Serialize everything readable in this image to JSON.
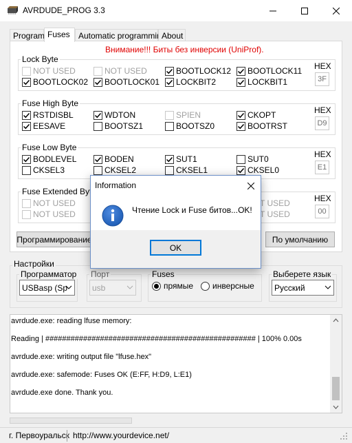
{
  "window": {
    "title": "AVRDUDE_PROG 3.3"
  },
  "tabs": [
    "Program",
    "Fuses",
    "Automatic programming",
    "About"
  ],
  "warning": "Внимание!!! Биты без инверсии (UniProf).",
  "lock_byte": {
    "title": "Lock Byte",
    "hex_label": "HEX",
    "hex_value": "3F",
    "bits": [
      {
        "label": "NOT USED",
        "checked": false,
        "disabled": true
      },
      {
        "label": "NOT USED",
        "checked": false,
        "disabled": true
      },
      {
        "label": "BOOTLOCK12",
        "checked": true,
        "disabled": false
      },
      {
        "label": "BOOTLOCK11",
        "checked": true,
        "disabled": false
      },
      {
        "label": "BOOTLOCK02",
        "checked": true,
        "disabled": false
      },
      {
        "label": "BOOTLOCK01",
        "checked": true,
        "disabled": false
      },
      {
        "label": "LOCKBIT2",
        "checked": true,
        "disabled": false
      },
      {
        "label": "LOCKBIT1",
        "checked": true,
        "disabled": false
      }
    ]
  },
  "fuse_high": {
    "title": "Fuse High Byte",
    "hex_label": "HEX",
    "hex_value": "D9",
    "bits": [
      {
        "label": "RSTDISBL",
        "checked": true,
        "disabled": false
      },
      {
        "label": "WDTON",
        "checked": true,
        "disabled": false
      },
      {
        "label": "SPIEN",
        "checked": false,
        "disabled": true
      },
      {
        "label": "CKOPT",
        "checked": true,
        "disabled": false
      },
      {
        "label": "EESAVE",
        "checked": true,
        "disabled": false
      },
      {
        "label": "BOOTSZ1",
        "checked": false,
        "disabled": false
      },
      {
        "label": "BOOTSZ0",
        "checked": false,
        "disabled": false
      },
      {
        "label": "BOOTRST",
        "checked": true,
        "disabled": false
      }
    ]
  },
  "fuse_low": {
    "title": "Fuse Low Byte",
    "hex_label": "HEX",
    "hex_value": "E1",
    "bits": [
      {
        "label": "BODLEVEL",
        "checked": true,
        "disabled": false
      },
      {
        "label": "BODEN",
        "checked": true,
        "disabled": false
      },
      {
        "label": "SUT1",
        "checked": true,
        "disabled": false
      },
      {
        "label": "SUT0",
        "checked": false,
        "disabled": false
      },
      {
        "label": "CKSEL3",
        "checked": false,
        "disabled": false
      },
      {
        "label": "CKSEL2",
        "checked": false,
        "disabled": false
      },
      {
        "label": "CKSEL1",
        "checked": false,
        "disabled": false
      },
      {
        "label": "CKSEL0",
        "checked": true,
        "disabled": false
      }
    ]
  },
  "fuse_ext": {
    "title": "Fuse Extended Byte",
    "hex_label": "HEX",
    "hex_value": "00",
    "bits": [
      {
        "label": "NOT USED",
        "checked": false,
        "disabled": true
      },
      {
        "label": "NOT USED",
        "checked": false,
        "disabled": true
      },
      {
        "label": "NOT USED",
        "checked": false,
        "disabled": true
      },
      {
        "label": "NOT USED",
        "checked": false,
        "disabled": true
      }
    ]
  },
  "buttons": {
    "program": "Программирование",
    "default": "По умолчанию"
  },
  "settings": {
    "title": "Настройки",
    "programmer_label": "Программатор",
    "programmer_value": "USBasp (Sp",
    "port_label": "Порт",
    "port_value": "usb",
    "fuses_label": "Fuses",
    "fuses_direct": "прямые",
    "fuses_inverse": "инверсные",
    "language_label": "Выберете язык",
    "language_value": "Русский"
  },
  "log": [
    "avrdude.exe: reading lfuse memory:",
    "Reading | ################################################## | 100% 0.00s",
    "avrdude.exe: writing output file \"lfuse.hex\"",
    "avrdude.exe: safemode: Fuses OK (E:FF, H:D9, L:E1)",
    "avrdude.exe done.  Thank you."
  ],
  "status": {
    "city": "г. Первоуральск",
    "url": "http://www.yourdevice.net/"
  },
  "dialog": {
    "title": "Information",
    "message": "Чтение Lock и Fuse битов...OK!",
    "ok": "OK"
  },
  "colors": {
    "warning": "#e00000",
    "accent": "#0078d7",
    "info_icon": "#1c5bb4"
  }
}
